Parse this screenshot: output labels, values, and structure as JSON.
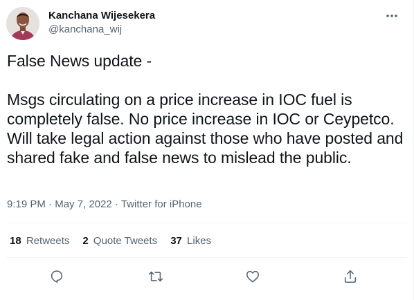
{
  "author": {
    "name": "Kanchana Wijesekera",
    "handle": "@kanchana_wij"
  },
  "tweet": {
    "text": "False News update -\n\nMsgs circulating on a price increase in IOC fuel is completely false. No price increase in IOC or Ceypetco. Will take legal action against those who have posted and shared fake and false news to mislead the public."
  },
  "meta": {
    "time": "9:19 PM",
    "separator": "·",
    "date": "May 7, 2022",
    "source": "Twitter for iPhone"
  },
  "stats": {
    "retweets_count": "18",
    "retweets_label": "Retweets",
    "quotes_count": "2",
    "quotes_label": "Quote Tweets",
    "likes_count": "37",
    "likes_label": "Likes"
  },
  "icons": {
    "more": "more-horizontal-icon",
    "reply": "reply-icon",
    "retweet": "retweet-icon",
    "like": "heart-icon",
    "share": "share-icon"
  },
  "colors": {
    "text": "#0f1419",
    "secondary": "#536471",
    "divider": "#eff3f4"
  }
}
